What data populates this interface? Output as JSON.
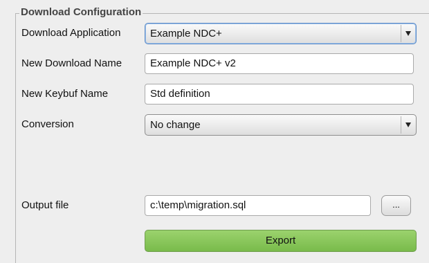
{
  "config": {
    "title": "Download Configuration",
    "download_app": {
      "label": "Download Application",
      "value": "Example NDC+"
    },
    "new_download_name": {
      "label": "New Download Name",
      "value": "Example NDC+ v2"
    },
    "new_keybuf_name": {
      "label": "New Keybuf Name",
      "value": "Std definition"
    },
    "conversion": {
      "label": "Conversion",
      "value": "No change"
    },
    "output_file": {
      "label": "Output file",
      "value": "c:\\temp\\migration.sql",
      "browse_label": "..."
    },
    "export_label": "Export"
  },
  "colors": {
    "export_green": "#86c45a",
    "focus_blue": "#5b8ac6"
  }
}
